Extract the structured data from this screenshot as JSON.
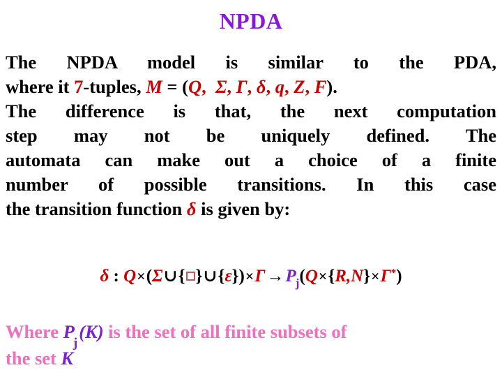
{
  "slide": {
    "title": "NPDA",
    "title_color": "#8A19D6",
    "background_color": "#ffffff",
    "accent_red": "#CC0000",
    "accent_purple": "#7B1FD4",
    "accent_pink": "#EE6FBD"
  },
  "paragraph1": {
    "line1": "The  NPDA  model  is  similar  to  the  PDA,",
    "line2": {
      "seg1": "where it ",
      "seg2_red": "7",
      "seg3": "-tuples, ",
      "seg4_red_italic": "M",
      "seg5": " = (",
      "tuple": [
        "Q",
        "Σ",
        "Γ",
        "δ",
        "q",
        "Z",
        "F"
      ],
      "seg_close": ")."
    }
  },
  "paragraph2": {
    "line1": "The difference is that, the next computation",
    "line2": "step   may   not   be   uniquely   defined.   The",
    "line3": "automata  can  make  out  a  choice  of  a  finite",
    "line4": "number  of  possible  transitions.  In  this  case",
    "line5_before": "the transition function ",
    "line5_delta": "δ",
    "line5_after": " is given by:"
  },
  "formula": {
    "delta": "δ",
    "colon": " : ",
    "Q1": "Q",
    "times1": "×",
    "paren_open": "(",
    "sigma": "Σ",
    "cup1": "∪",
    "brace_open1": "{",
    "box": "□",
    "brace_close1": "}",
    "cup2": "∪",
    "brace_open2": "{",
    "epsilon": "ε",
    "brace_close2": "}",
    "paren_close1": ")",
    "times2": "×",
    "gamma1": "Γ",
    "arrow": "→",
    "P": "P",
    "P_sub": "j",
    "paren_open2": "(",
    "Q2": "Q",
    "times3": "×",
    "brace_open3": "{",
    "R": "R",
    "comma": ",",
    "N": "N",
    "brace_close3": "}",
    "times4": "×",
    "gamma2": "Γ",
    "gamma2_sup": "*",
    "paren_close2": ")"
  },
  "footer": {
    "line1_seg1": "Where ",
    "line1_P": "P",
    "line1_P_sub": "j",
    "line1_paren_K": "(K)",
    "line1_seg2": " is the set of all finite subsets of",
    "line2_seg1": "the set ",
    "line2_K": "K"
  }
}
